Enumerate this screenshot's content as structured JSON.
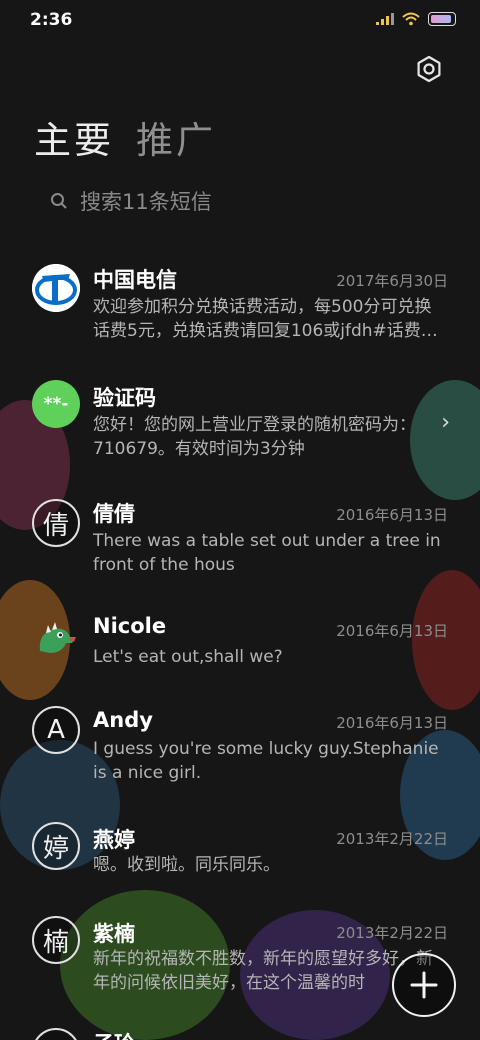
{
  "status_bar": {
    "time": "2:36"
  },
  "tabs": [
    {
      "label": "主要"
    },
    {
      "label": "推广"
    }
  ],
  "search": {
    "placeholder": "搜索11条短信"
  },
  "conversations": [
    {
      "name": "中国电信",
      "date": "2017年6月30日",
      "preview": "欢迎参加积分兑换话费活动，每500分可兑换话费5元，兑换话费请回复106或jfdh#话费…",
      "avatar_type": "telecom-logo"
    },
    {
      "name": "验证码",
      "date": "",
      "preview": "您好！您的网上营业厅登录的随机密码为：710679。有效时间为3分钟",
      "avatar_type": "code-badge",
      "avatar_text": "**-"
    },
    {
      "name": "倩倩",
      "date": "2016年6月13日",
      "preview": "There was a table set out under a tree in front of the hous",
      "avatar_letter": "倩"
    },
    {
      "name": "Nicole",
      "date": "2016年6月13日",
      "preview": "Let's eat out,shall we?",
      "avatar_type": "dinosaur"
    },
    {
      "name": "Andy",
      "date": "2016年6月13日",
      "preview": "I guess you're some lucky guy.Stephanie is a nice girl.",
      "avatar_letter": "A"
    },
    {
      "name": "燕婷",
      "date": "2013年2月22日",
      "preview": "嗯。收到啦。同乐同乐。",
      "avatar_letter": "婷"
    },
    {
      "name": "紫楠",
      "date": "2013年2月22日",
      "preview": "新年的祝福数不胜数，新年的愿望好多好，新年的问候依旧美好，在这个温馨的时",
      "avatar_letter": "楠"
    },
    {
      "name": "子玲",
      "date": "",
      "preview": ""
    }
  ],
  "colors": {
    "background": "#161616",
    "code_badge": "#5fd05a",
    "telecom_blue": "#0a6ec8"
  }
}
